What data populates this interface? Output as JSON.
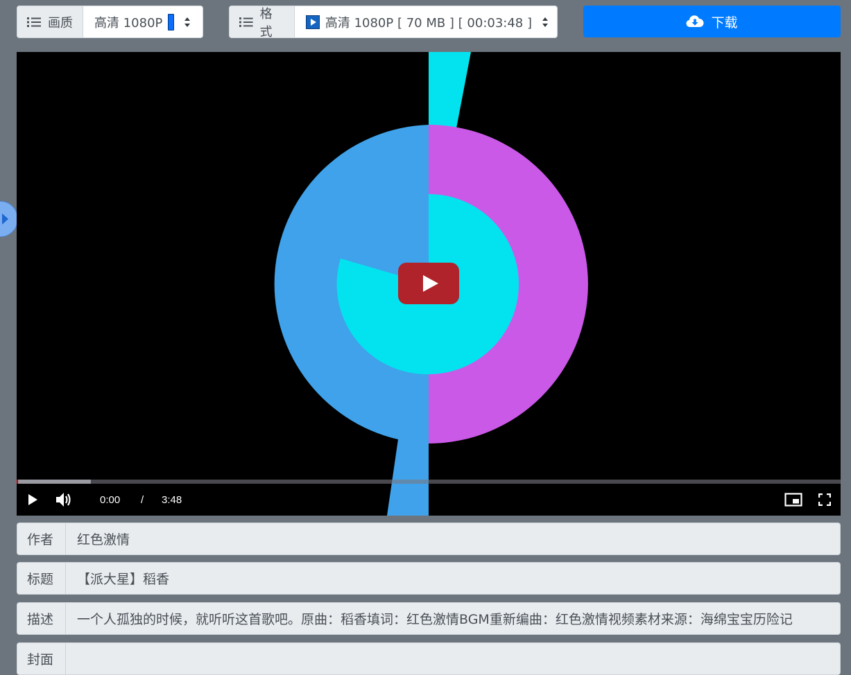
{
  "toolbar": {
    "quality": {
      "label": "画质",
      "value": "高清 1080P"
    },
    "format": {
      "label": "格式",
      "value": "高清 1080P [ 70 MB ] [ 00:03:48 ]"
    },
    "download_label": "下载"
  },
  "player": {
    "current_time": "0:00",
    "separator": "/",
    "duration": "3:48",
    "played_fraction": 0.0,
    "buffered_fraction": 0.09
  },
  "fields": [
    {
      "label": "作者",
      "value": "红色激情"
    },
    {
      "label": "标题",
      "value": "【派大星】稻香"
    },
    {
      "label": "描述",
      "value": "一个人孤独的时候，就听听这首歌吧。原曲：稻香填词：红色激情BGM重新编曲：红色激情视频素材来源：海绵宝宝历险记"
    },
    {
      "label": "封面",
      "value": ""
    }
  ],
  "colors": {
    "page_bg": "#6c757d",
    "accent": "#007bff",
    "play_button": "#b0232a",
    "art_blue": "#3fa2ea",
    "art_purple": "#cb59e8",
    "art_cyan": "#03e3ef"
  }
}
